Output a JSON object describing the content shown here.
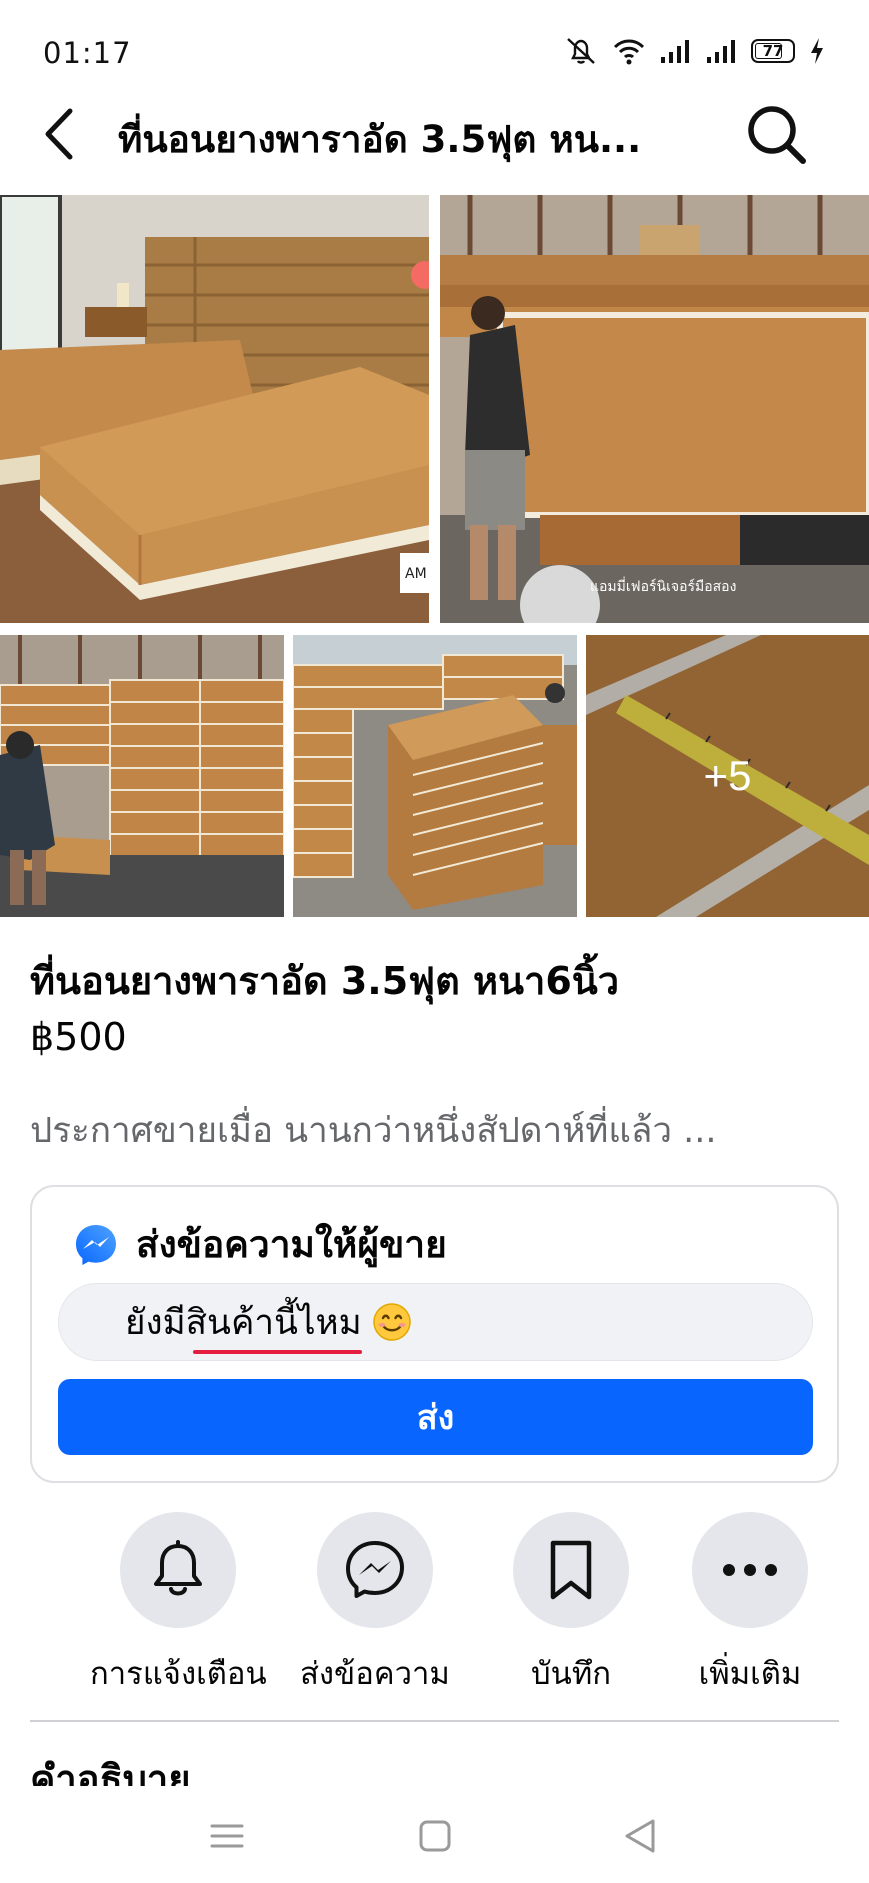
{
  "status_bar": {
    "time": "01:17",
    "battery": "77",
    "icons": [
      "mute-icon",
      "wifi-icon",
      "signal-icon",
      "signal-icon",
      "battery-icon",
      "charging-icon"
    ]
  },
  "header": {
    "title": "ที่นอนยางพาราอัด 3.5ฟุต หน...",
    "back_icon": "back-arrow-icon",
    "search_icon": "search-icon"
  },
  "gallery": {
    "more_count": "+5",
    "watermark_text": "แอมมี่เฟอร์นิเจอร์มือสอง"
  },
  "listing": {
    "title": "ที่นอนยางพาราอัด 3.5ฟุต หนา6นิ้ว",
    "price": "฿500",
    "meta": "ประกาศขายเมื่อ นานกว่าหนึ่งสัปดาห์ที่แล้ว ..."
  },
  "message_card": {
    "header": "ส่งข้อความให้ผู้ขาย",
    "input_value": "ยังมีสินค้านี้ไหม",
    "send_label": "ส่ง",
    "accent_color": "#0866ff"
  },
  "actions": [
    {
      "label": "การแจ้งเตือน",
      "icon": "bell-icon"
    },
    {
      "label": "ส่งข้อความ",
      "icon": "messenger-icon"
    },
    {
      "label": "บันทึก",
      "icon": "bookmark-icon"
    },
    {
      "label": "เพิ่มเติม",
      "icon": "more-icon"
    }
  ],
  "description": {
    "heading": "คำอธิบาย"
  },
  "system_nav": [
    "menu-icon",
    "home-icon",
    "back-icon"
  ]
}
